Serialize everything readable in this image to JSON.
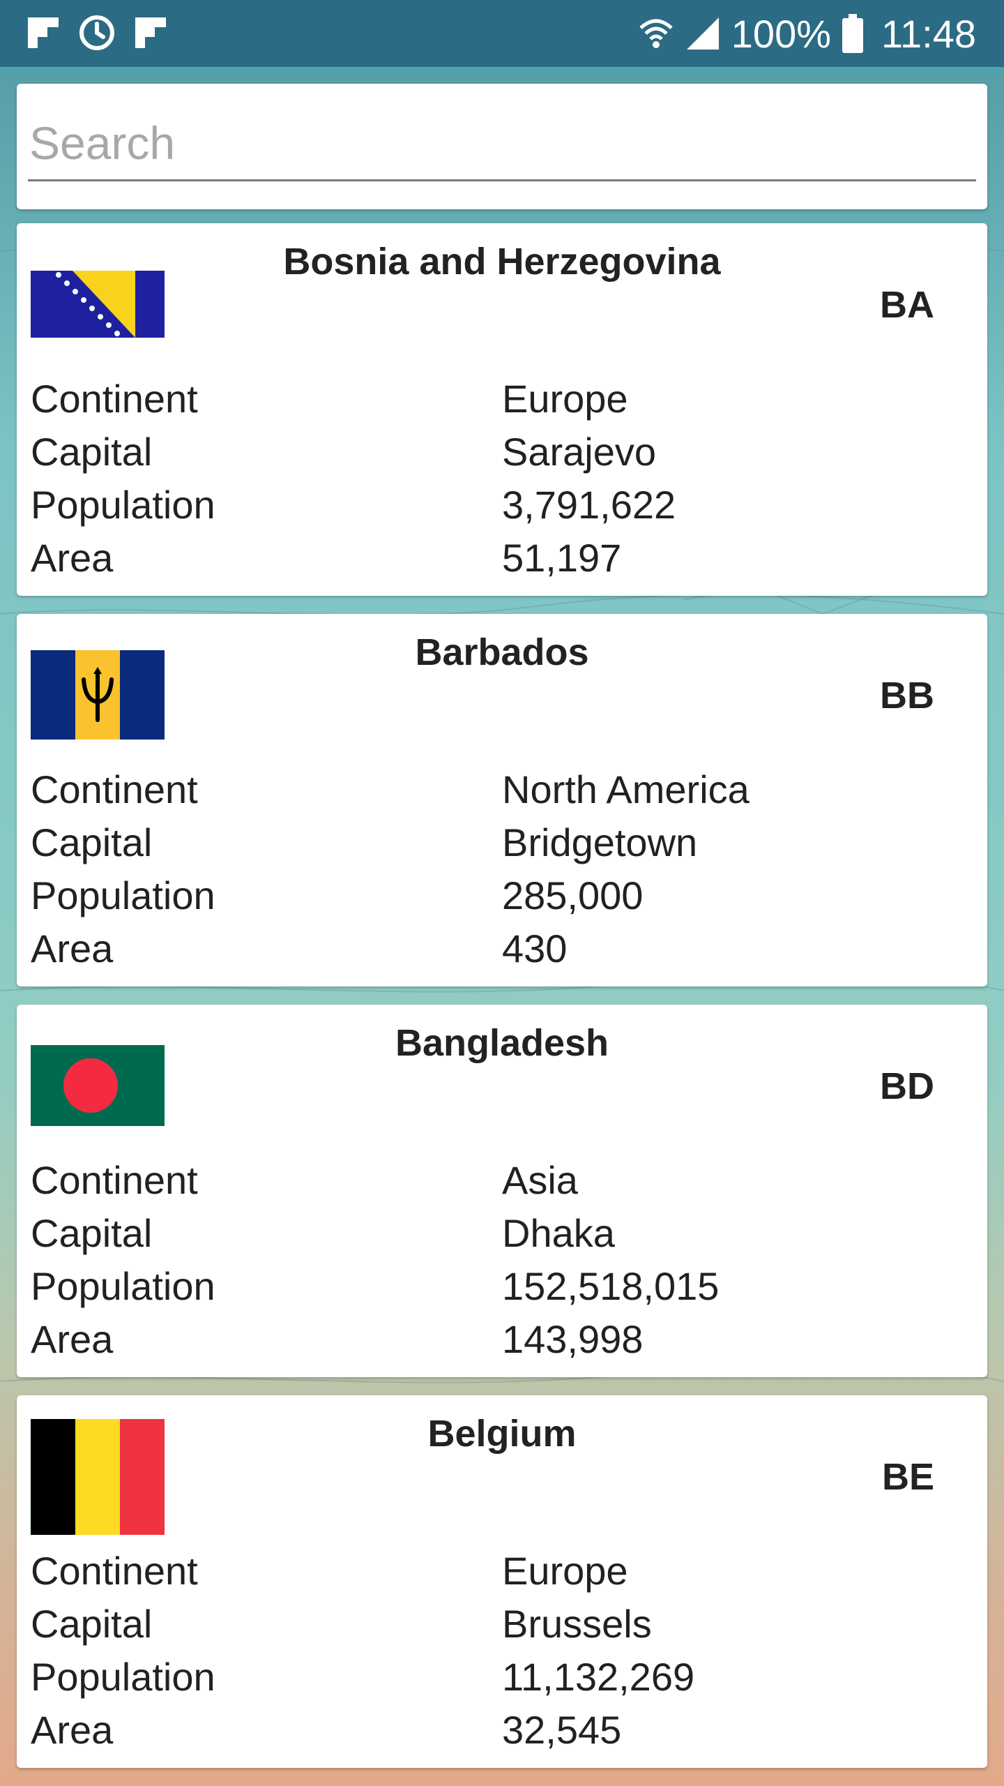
{
  "status_bar": {
    "battery": "100%",
    "time": "11:48",
    "left_icons": [
      "flipboard-icon",
      "sync-icon",
      "flipboard-icon"
    ],
    "right_icons": [
      "wifi-icon",
      "signal-icon",
      "battery-icon"
    ]
  },
  "search": {
    "placeholder": "Search",
    "value": ""
  },
  "labels": {
    "continent": "Continent",
    "capital": "Capital",
    "population": "Population",
    "area": "Area"
  },
  "countries": [
    {
      "name": "Bosnia and Herzegovina",
      "code": "BA",
      "flag": "bosnia-flag",
      "continent": "Europe",
      "capital": "Sarajevo",
      "population": "3,791,622",
      "area": "51,197",
      "colors": {
        "blue": "#1e20a0",
        "yellow": "#f8d21c",
        "white": "#ffffff"
      }
    },
    {
      "name": "Barbados",
      "code": "BB",
      "flag": "barbados-flag",
      "continent": "North America",
      "capital": "Bridgetown",
      "population": "285,000",
      "area": "430",
      "colors": {
        "blue": "#0a2a7c",
        "gold": "#f9c22e",
        "black": "#000000"
      }
    },
    {
      "name": "Bangladesh",
      "code": "BD",
      "flag": "bangladesh-flag",
      "continent": "Asia",
      "capital": "Dhaka",
      "population": "152,518,015",
      "area": "143,998",
      "colors": {
        "green": "#006a4e",
        "red": "#f42a41"
      }
    },
    {
      "name": "Belgium",
      "code": "BE",
      "flag": "belgium-flag",
      "continent": "Europe",
      "capital": "Brussels",
      "population": "11,132,269",
      "area": "32,545",
      "colors": {
        "black": "#000000",
        "yellow": "#fdda24",
        "red": "#ef3340"
      }
    }
  ]
}
